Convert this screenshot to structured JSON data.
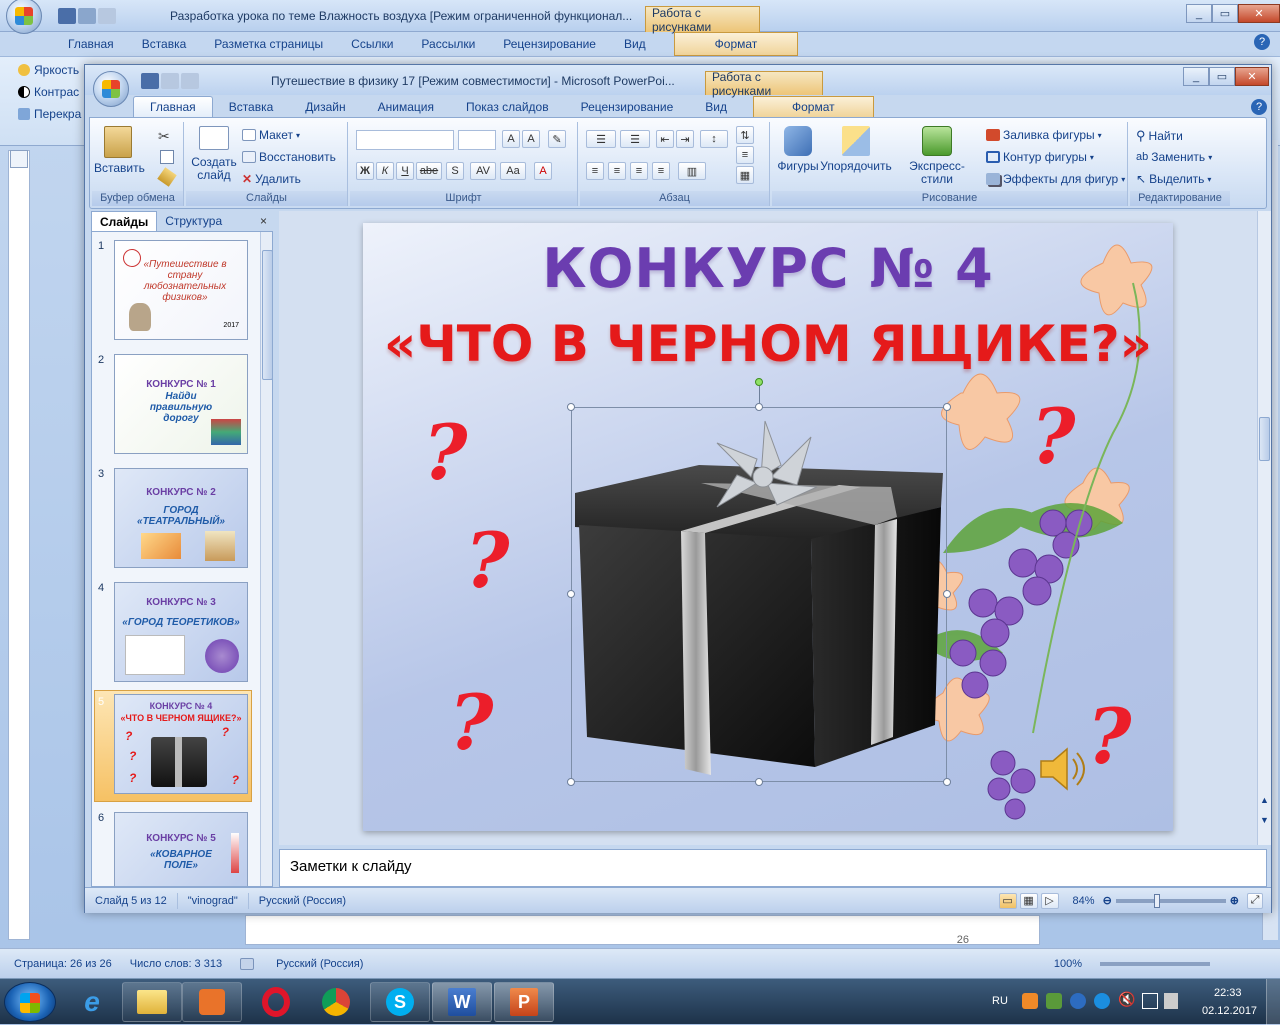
{
  "word": {
    "title": "Разработка урока по теме Влажность воздуха [Режим ограниченной функционал...",
    "context_tab": "Работа с рисунками",
    "tabs": [
      "Главная",
      "Вставка",
      "Разметка страницы",
      "Ссылки",
      "Рассылки",
      "Рецензирование",
      "Вид",
      "Формат"
    ],
    "ribbon_items": [
      "Яркость",
      "Контрас",
      "Перекра"
    ],
    "page_number": "26",
    "status": {
      "page": "Страница: 26 из 26",
      "words": "Число слов: 3 313",
      "language": "Русский (Россия)",
      "zoom": "100%"
    }
  },
  "ppt": {
    "title": "Путешествие  в физику 17 [Режим совместимости] - Microsoft PowerPoi...",
    "context_tab": "Работа с рисунками",
    "tabs": [
      "Главная",
      "Вставка",
      "Дизайн",
      "Анимация",
      "Показ слайдов",
      "Рецензирование",
      "Вид",
      "Формат"
    ],
    "active_tab": "Главная",
    "groups": {
      "clipboard": {
        "label": "Буфер обмена",
        "paste": "Вставить"
      },
      "slides": {
        "label": "Слайды",
        "new_slide": "Создать слайд",
        "layout": "Макет",
        "reset": "Восстановить",
        "delete": "Удалить"
      },
      "font": {
        "label": "Шрифт",
        "bold": "Ж",
        "italic": "К",
        "underline": "Ч",
        "strike": "abe",
        "shadow": "S",
        "spacing": "AV",
        "case": "Aa"
      },
      "paragraph": {
        "label": "Абзац"
      },
      "drawing": {
        "label": "Рисование",
        "shapes": "Фигуры",
        "arrange": "Упорядочить",
        "quick_styles": "Экспресс-стили",
        "fill": "Заливка фигуры",
        "outline": "Контур фигуры",
        "effects": "Эффекты для фигур"
      },
      "editing": {
        "label": "Редактирование",
        "find": "Найти",
        "replace": "Заменить",
        "select": "Выделить"
      }
    },
    "pane_tabs": [
      "Слайды",
      "Структура"
    ],
    "thumbnails": [
      {
        "n": "1",
        "t1": "«Путешествие в страну любознательных физиков»",
        "t2": "",
        "year": "2017"
      },
      {
        "n": "2",
        "t1": "КОНКУРС № 1",
        "t2": "Найди правильную дорогу"
      },
      {
        "n": "3",
        "t1": "КОНКУРС № 2",
        "t2": "ГОРОД «ТЕАТРАЛЬНЫЙ»"
      },
      {
        "n": "4",
        "t1": "КОНКУРС № 3",
        "t2": "«ГОРОД ТЕОРЕТИКОВ»"
      },
      {
        "n": "5",
        "t1": "КОНКУРС № 4",
        "t2": "«ЧТО В ЧЕРНОМ ЯЩИКЕ?»"
      },
      {
        "n": "6",
        "t1": "КОНКУРС № 5",
        "t2": "«КОВАРНОЕ ПОЛЕ»"
      }
    ],
    "selected_slide": 5,
    "slide": {
      "title1": "КОНКУРС № 4",
      "title2": "«ЧТО В ЧЕРНОМ ЯЩИКЕ?»",
      "question_mark": "?"
    },
    "notes_placeholder": "Заметки к слайду",
    "status": {
      "slide": "Слайд 5 из 12",
      "theme": "\"vinograd\"",
      "language": "Русский (Россия)",
      "zoom": "84%"
    }
  },
  "tray": {
    "lang": "RU",
    "time": "22:33",
    "date": "02.12.2017"
  },
  "colors": {
    "title1": "#6b3db0",
    "title2": "#e51a1a",
    "question": "#ec1e2a",
    "ribbon": "#dbe7f7"
  }
}
